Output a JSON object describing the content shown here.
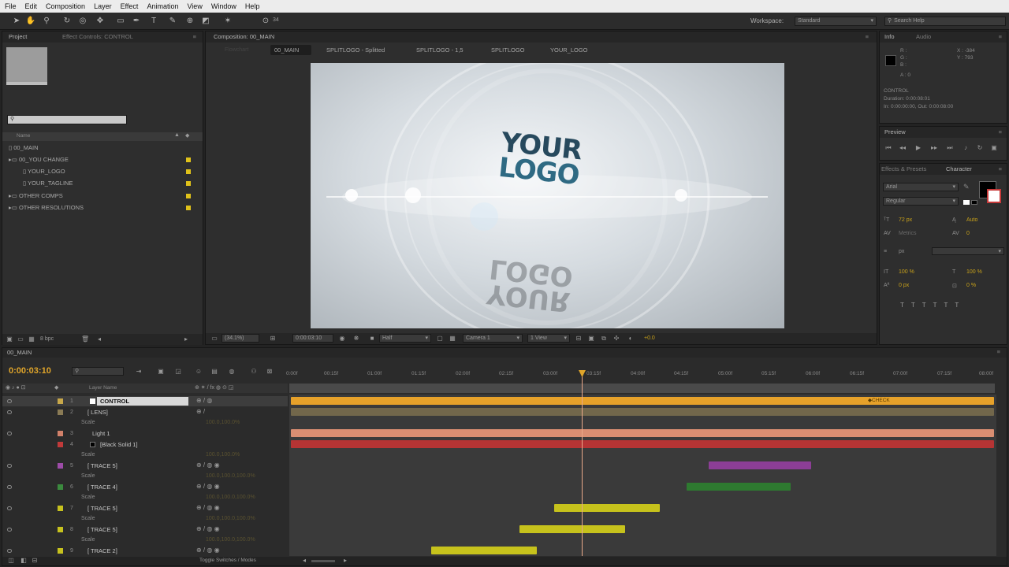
{
  "menubar": [
    "File",
    "Edit",
    "Composition",
    "Layer",
    "Effect",
    "Animation",
    "View",
    "Window",
    "Help"
  ],
  "toolbar": {
    "workspace_label": "Workspace:",
    "workspace_value": "Standard",
    "search_placeholder": "Search Help",
    "zoom_value": "34"
  },
  "project": {
    "tab_project": "Project",
    "tab_effects": "Effect Controls: CONTROL",
    "search_placeholder": "",
    "col_name": "Name",
    "items": [
      {
        "label": "00_MAIN"
      },
      {
        "label": "00_YOU CHANGE"
      },
      {
        "label": "YOUR_LOGO"
      },
      {
        "label": "YOUR_TAGLINE"
      },
      {
        "label": "OTHER COMPS"
      },
      {
        "label": "OTHER RESOLUTIONS"
      }
    ],
    "bpc": "8 bpc"
  },
  "composition": {
    "tab_label": "Composition: 00_MAIN",
    "flowchart_label": "Flowchart",
    "breadcrumbs": [
      "00_MAIN",
      "SPLITLOGO - Splitted",
      "SPLITLOGO - 1,5",
      "SPLITLOGO",
      "YOUR_LOGO"
    ],
    "logo_line1": "YOUR",
    "logo_line2": "LOGO",
    "footer": {
      "zoom": "(34.1%)",
      "timecode": "0:00:03:10",
      "resolution": "Half",
      "camera": "Camera 1",
      "view": "1 View",
      "exposure": "+0.0"
    }
  },
  "info": {
    "tab_info": "Info",
    "tab_audio": "Audio",
    "r": "R :",
    "g": "G :",
    "b": "B :",
    "a": "A : 0",
    "x": "X : -384",
    "y": "Y : 793",
    "layer_name": "CONTROL",
    "duration": "Duration: 0:00:08:01",
    "in_out": "In: 0:00:00:00, Out: 0:00:08:00"
  },
  "preview": {
    "tab_label": "Preview"
  },
  "character": {
    "tab_effects": "Effects & Presets",
    "tab_character": "Character",
    "font": "Arial",
    "style": "Regular",
    "size": "72 px",
    "leading": "Auto",
    "kerning": "Metrics",
    "tracking": "0",
    "stroke_width": "px",
    "stroke_mode": "",
    "v_scale": "100 %",
    "h_scale": "100 %",
    "baseline": "0 px",
    "tsume": "0 %"
  },
  "timeline": {
    "tab_label": "00_MAIN",
    "timecode": "0:00:03:10",
    "col_layer_name": "Layer Name",
    "ruler": [
      "0:00f",
      "00:15f",
      "01:00f",
      "01:15f",
      "02:00f",
      "02:15f",
      "03:00f",
      "03:15f",
      "04:00f",
      "04:15f",
      "05:00f",
      "05:15f",
      "06:00f",
      "06:15f",
      "07:00f",
      "07:15f",
      "08:00f"
    ],
    "layers": [
      {
        "num": "1",
        "name": "CONTROL",
        "color": "#c8a84a"
      },
      {
        "num": "2",
        "name": "[ LENS]",
        "color": "#8a7b55",
        "prop": "Scale",
        "val": "100.0,100.0%"
      },
      {
        "num": "3",
        "name": "Light 1",
        "color": "#d2816a"
      },
      {
        "num": "4",
        "name": "[Black Solid 1]",
        "color": "#c13a3a",
        "prop": "Scale",
        "val": "100.0,100.0%"
      },
      {
        "num": "5",
        "name": "[ TRACE 5]",
        "color": "#9d4ca8",
        "prop": "Scale",
        "val": "100.0,100.0,100.0%"
      },
      {
        "num": "6",
        "name": "[ TRACE 4]",
        "color": "#3b8a3e",
        "prop": "Scale",
        "val": "100.0,100.0,100.0%"
      },
      {
        "num": "7",
        "name": "[ TRACE 5]",
        "color": "#c7c21e",
        "prop": "Scale",
        "val": "100.0,100.0,100.0%"
      },
      {
        "num": "8",
        "name": "[ TRACE 5]",
        "color": "#c7c21e",
        "prop": "Scale",
        "val": "100.0,100.0,100.0%"
      },
      {
        "num": "9",
        "name": "[ TRACE 2]",
        "color": "#c7c21e"
      }
    ],
    "marker_label": "CHECK",
    "footer_toggle": "Toggle Switches / Modes"
  },
  "colors": {
    "accent": "#e0a52a",
    "playhead": "#e9a98a",
    "control_bar": "#e6a12a",
    "light_bar": "#d98e72",
    "solid_bar": "#b53434",
    "trace_purple": "#8c3e96",
    "trace_green": "#2e7a30",
    "trace_yellow": "#c6c21c"
  }
}
